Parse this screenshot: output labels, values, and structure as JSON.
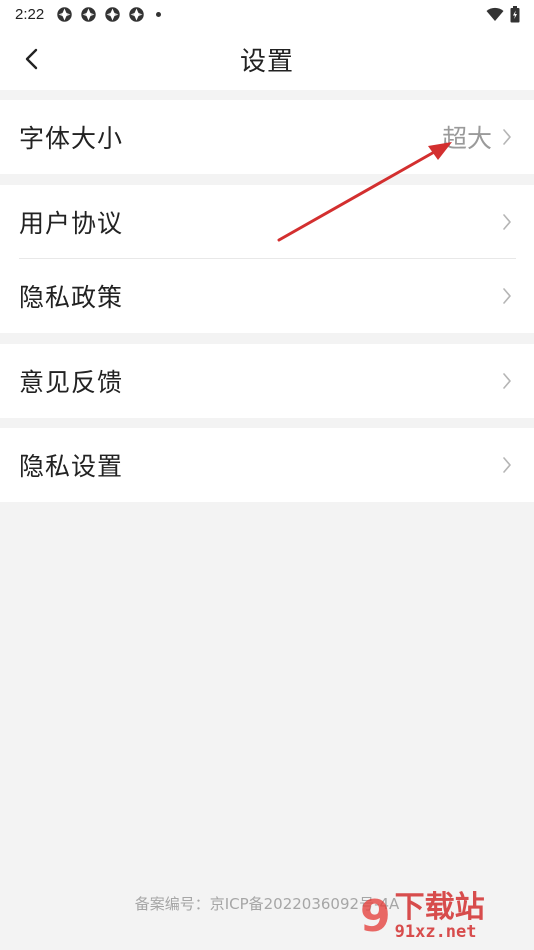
{
  "status_bar": {
    "time": "2:22",
    "notification_icons": [
      "app-notification-icon",
      "app-notification-icon",
      "app-notification-icon",
      "app-notification-icon"
    ],
    "right_icons": [
      "wifi-icon",
      "battery-icon"
    ]
  },
  "header": {
    "title": "设置",
    "back_icon": "back-arrow-icon"
  },
  "settings": {
    "font_size": {
      "label": "字体大小",
      "value": "超大"
    },
    "user_agreement": {
      "label": "用户协议"
    },
    "privacy_policy": {
      "label": "隐私政策"
    },
    "feedback": {
      "label": "意见反馈"
    },
    "privacy_settings": {
      "label": "隐私设置"
    }
  },
  "footer": {
    "icp": "备案编号：京ICP备2022036092号-4A"
  },
  "watermark": {
    "number": "9",
    "site_name": "下载站",
    "site_url": "91xz.net"
  },
  "colors": {
    "background": "#f3f3f3",
    "card": "#ffffff",
    "text": "#222222",
    "secondary_text": "#9a9a9a",
    "annotation_arrow": "#d32f2f"
  }
}
